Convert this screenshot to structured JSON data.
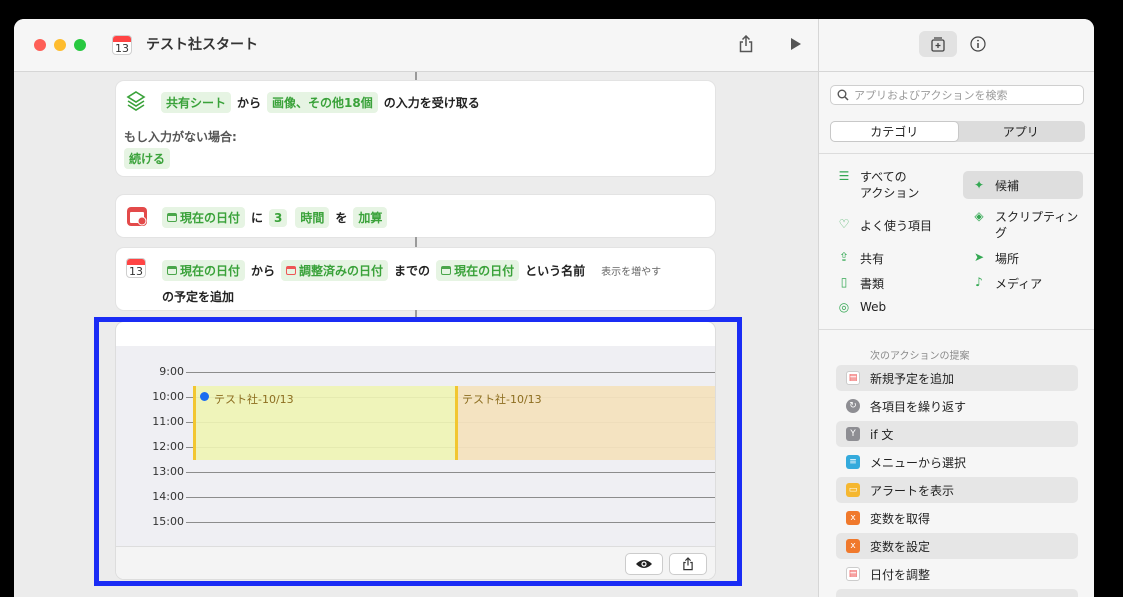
{
  "window": {
    "title": "テスト社スタート",
    "calendar_icon_day": "13"
  },
  "actions": {
    "receive": {
      "token_source": "共有シート",
      "word_from": "から",
      "token_types": "画像、その他18個",
      "word_receive": "の入力を受け取る",
      "no_input_label": "もし入力がない場合:",
      "token_continue": "続ける"
    },
    "adjust": {
      "token_date": "現在の日付",
      "word_ni": "に",
      "token_amount": "3",
      "token_unit": "時間",
      "word_wo": "を",
      "token_op": "加算"
    },
    "add_event": {
      "token_start": "現在の日付",
      "word_from": "から",
      "token_end": "調整済みの日付",
      "word_until": "までの",
      "token_name": "現在の日付",
      "word_named": "という名前",
      "show_more": "表示を増やす",
      "line2": "の予定を追加"
    }
  },
  "preview": {
    "hours": [
      "9:00",
      "10:00",
      "11:00",
      "12:00",
      "13:00",
      "14:00",
      "15:00"
    ],
    "events": [
      {
        "title": "テスト社-10/13"
      },
      {
        "title": "テスト社-10/13"
      }
    ],
    "eye_icon": "eye-icon",
    "share_icon": "share-icon"
  },
  "sidebar": {
    "search_placeholder": "アプリおよびアクションを検索",
    "segments": [
      "カテゴリ",
      "アプリ"
    ],
    "categories": [
      {
        "label": "すべての\nアクション",
        "icon": "list-icon"
      },
      {
        "label": "候補",
        "icon": "sparkle-icon"
      },
      {
        "label": "よく使う項目",
        "icon": "heart-icon"
      },
      {
        "label": "スクリプティン\nグ",
        "icon": "scripting-icon"
      },
      {
        "label": "共有",
        "icon": "share-icon"
      },
      {
        "label": "場所",
        "icon": "location-icon"
      },
      {
        "label": "書類",
        "icon": "document-icon"
      },
      {
        "label": "メディア",
        "icon": "music-icon"
      },
      {
        "label": "Web",
        "icon": "compass-icon"
      }
    ],
    "suggestions_heading": "次のアクションの提案",
    "suggestions": [
      {
        "label": "新規予定を追加",
        "color": "#ffffff"
      },
      {
        "label": "各項目を繰り返す",
        "color": "#8e8e93"
      },
      {
        "label": "if 文",
        "color": "#8e8e93"
      },
      {
        "label": "メニューから選択",
        "color": "#34aadc"
      },
      {
        "label": "アラートを表示",
        "color": "#f5b730"
      },
      {
        "label": "変数を取得",
        "color": "#f0792c"
      },
      {
        "label": "変数を設定",
        "color": "#f0792c"
      },
      {
        "label": "日付を調整",
        "color": "#ffffff"
      }
    ]
  },
  "colors": {
    "highlight": "#1a2cf5",
    "token_bg": "#e6f4e3",
    "token_fg": "#3aa23a",
    "event_border": "#f2c630"
  }
}
